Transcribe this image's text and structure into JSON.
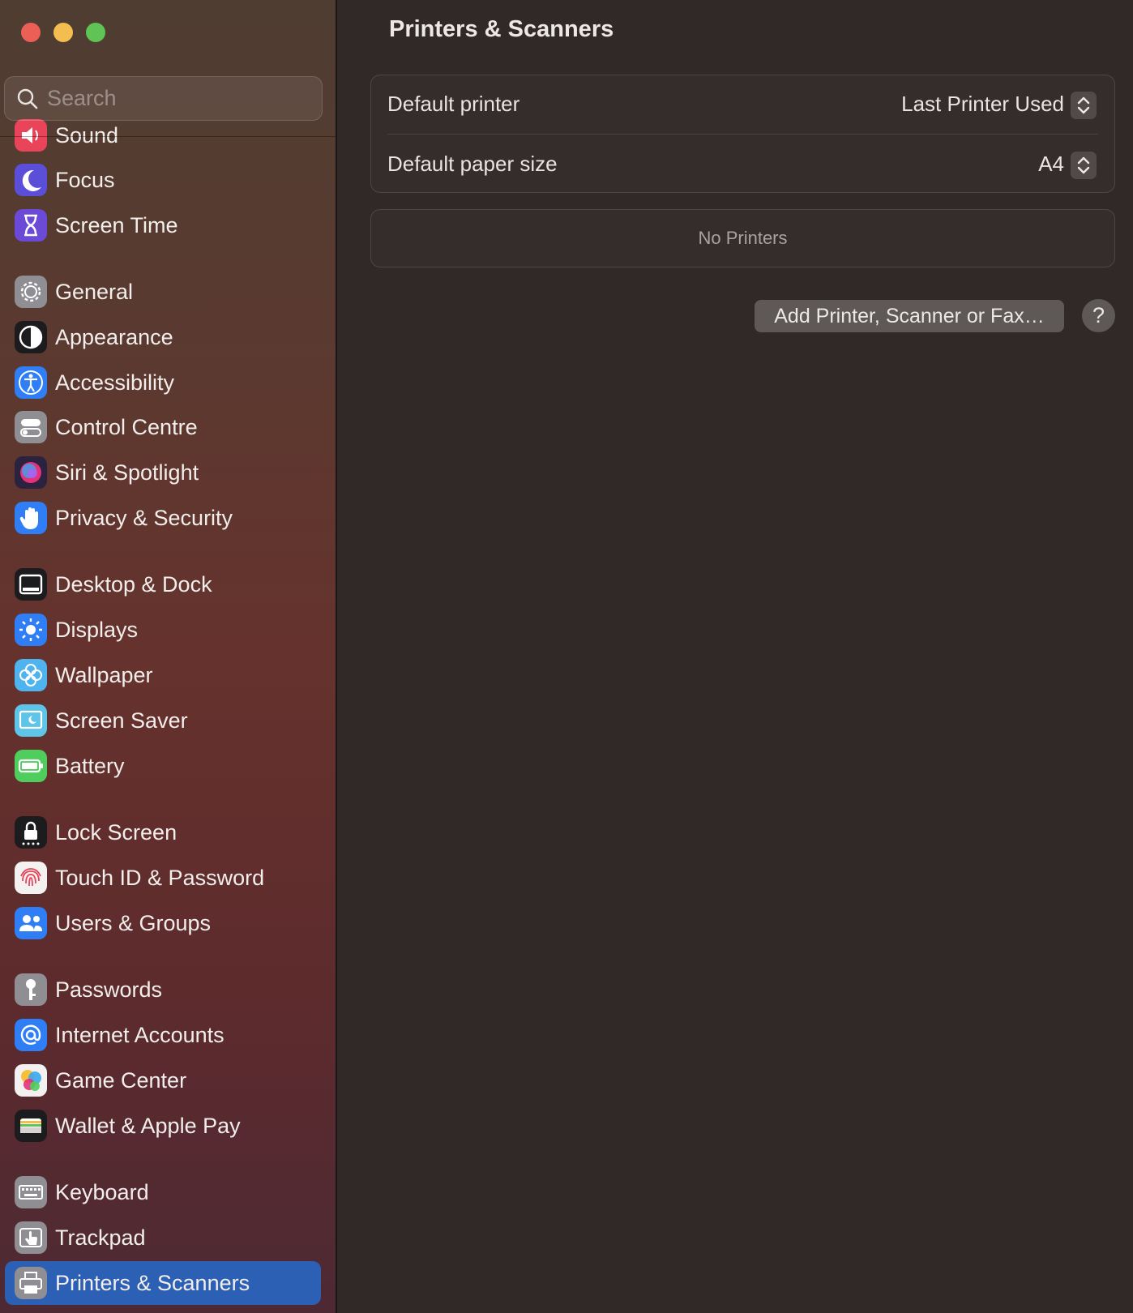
{
  "window": {
    "controls": [
      "close",
      "minimize",
      "maximize"
    ]
  },
  "search": {
    "placeholder": "Search"
  },
  "sidebar": {
    "items": [
      {
        "label": "Sound",
        "icon": "speaker-icon",
        "color": "#e9445a"
      },
      {
        "label": "Focus",
        "icon": "moon-icon",
        "color": "#5b4fd9"
      },
      {
        "label": "Screen Time",
        "icon": "hourglass-icon",
        "color": "#6a4ad6"
      },
      {
        "label": "General",
        "icon": "gear-icon",
        "color": "#8e8e93"
      },
      {
        "label": "Appearance",
        "icon": "appearance-icon",
        "color": "#1c1c1e"
      },
      {
        "label": "Accessibility",
        "icon": "accessibility-icon",
        "color": "#2f7ef6"
      },
      {
        "label": "Control Centre",
        "icon": "toggles-icon",
        "color": "#8e8e93"
      },
      {
        "label": "Siri & Spotlight",
        "icon": "siri-icon",
        "color": "#2b2240"
      },
      {
        "label": "Privacy & Security",
        "icon": "hand-icon",
        "color": "#2f7ef6"
      },
      {
        "label": "Desktop & Dock",
        "icon": "dock-icon",
        "color": "#1c1c1e"
      },
      {
        "label": "Displays",
        "icon": "sun-icon",
        "color": "#2f7ef6"
      },
      {
        "label": "Wallpaper",
        "icon": "flower-icon",
        "color": "#4fb3f0"
      },
      {
        "label": "Screen Saver",
        "icon": "screen-saver-icon",
        "color": "#5ec4e8"
      },
      {
        "label": "Battery",
        "icon": "battery-icon",
        "color": "#4fce5d"
      },
      {
        "label": "Lock Screen",
        "icon": "lock-icon",
        "color": "#1c1c1e"
      },
      {
        "label": "Touch ID & Password",
        "icon": "fingerprint-icon",
        "color": "#f4f1f1"
      },
      {
        "label": "Users & Groups",
        "icon": "users-icon",
        "color": "#2f7ef6"
      },
      {
        "label": "Passwords",
        "icon": "key-icon",
        "color": "#8e8e93"
      },
      {
        "label": "Internet Accounts",
        "icon": "at-icon",
        "color": "#2f7ef6"
      },
      {
        "label": "Game Center",
        "icon": "game-center-icon",
        "color": "#f4f1f1"
      },
      {
        "label": "Wallet & Apple Pay",
        "icon": "wallet-icon",
        "color": "#1c1c1e"
      },
      {
        "label": "Keyboard",
        "icon": "keyboard-icon",
        "color": "#8e8e93"
      },
      {
        "label": "Trackpad",
        "icon": "trackpad-icon",
        "color": "#8e8e93"
      },
      {
        "label": "Printers & Scanners",
        "icon": "printer-icon",
        "color": "#8e8e93",
        "selected": true
      }
    ]
  },
  "main": {
    "title": "Printers & Scanners",
    "default_printer": {
      "label": "Default printer",
      "value": "Last Printer Used"
    },
    "default_paper": {
      "label": "Default paper size",
      "value": "A4"
    },
    "printers_empty": "No Printers",
    "add_button": "Add Printer, Scanner or Fax…",
    "help_label": "?"
  },
  "colors": {
    "accent": "#2c60b4",
    "background": "#312927"
  }
}
